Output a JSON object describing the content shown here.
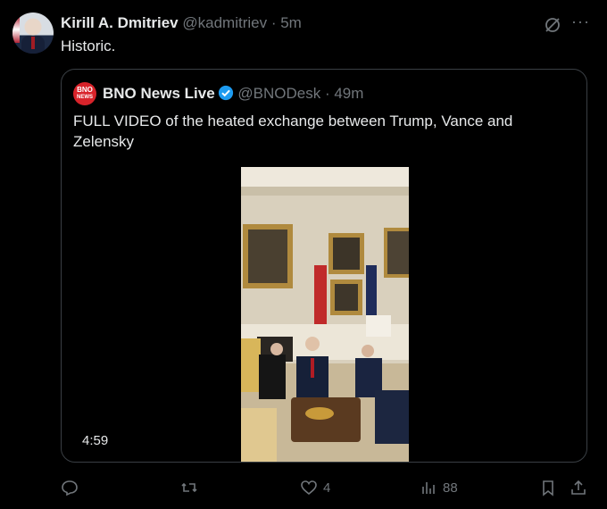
{
  "author": {
    "name": "Kirill A. Dmitriev",
    "handle": "@kadmitriev",
    "time": "· 5m"
  },
  "tweet_text": "Historic.",
  "quote": {
    "logo_line1": "BNO",
    "logo_line2": "NEWS",
    "name": "BNO News Live",
    "handle": "@BNODesk",
    "time": "· 49m",
    "text": "FULL VIDEO of the heated exchange between Trump, Vance and Zelensky",
    "video_duration": "4:59"
  },
  "actions": {
    "likes": "4",
    "views": "88"
  },
  "colors": {
    "background": "#000000",
    "text": "#e7e9ea",
    "muted": "#71767b",
    "verified": "#1d9bf0",
    "logo": "#d8232a"
  }
}
